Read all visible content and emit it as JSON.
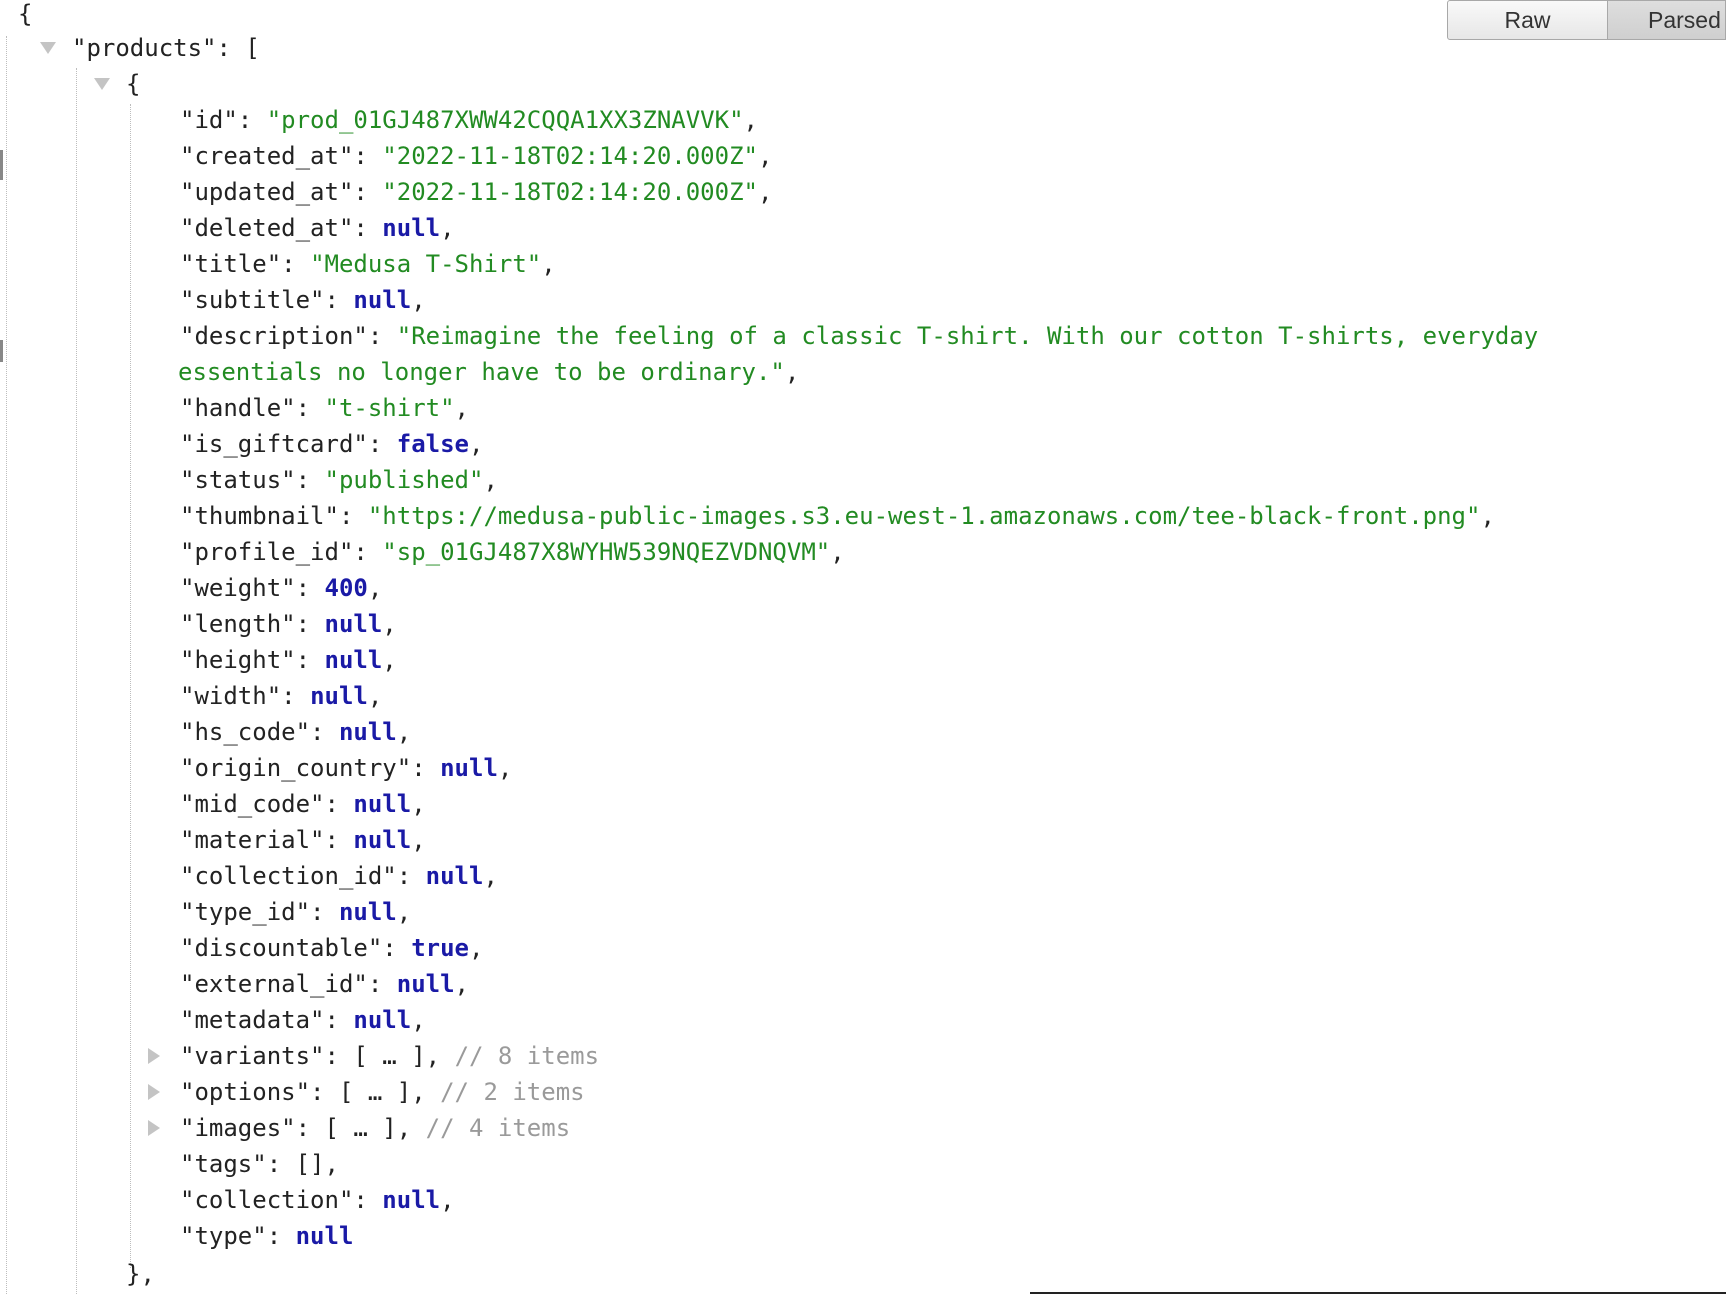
{
  "view_toggle": {
    "raw_label": "Raw",
    "parsed_label": "Parsed"
  },
  "colors": {
    "string": "#228b22",
    "keyword": "#1a1aa6",
    "comment": "#9a9a9a",
    "key": "#222222",
    "guide": "#bdbdbd",
    "toggle": "#c4c4c4"
  },
  "json": {
    "root_open": "{",
    "products_key": "\"products\"",
    "products_open": ": [",
    "item_open": "{",
    "item_close": "},",
    "fields": [
      {
        "key": "\"id\"",
        "value": "\"prod_01GJ487XWW42CQQA1XX3ZNAVVK\"",
        "kind": "str",
        "trail": ","
      },
      {
        "key": "\"created_at\"",
        "value": "\"2022-11-18T02:14:20.000Z\"",
        "kind": "str",
        "trail": ","
      },
      {
        "key": "\"updated_at\"",
        "value": "\"2022-11-18T02:14:20.000Z\"",
        "kind": "str",
        "trail": ","
      },
      {
        "key": "\"deleted_at\"",
        "value": "null",
        "kind": "kw",
        "trail": ","
      },
      {
        "key": "\"title\"",
        "value": "\"Medusa T-Shirt\"",
        "kind": "str",
        "trail": ","
      },
      {
        "key": "\"subtitle\"",
        "value": "null",
        "kind": "kw",
        "trail": ","
      },
      {
        "key": "\"description\"",
        "value": "\"Reimagine the feeling of a classic T-shirt. With our cotton T-shirts, everyday",
        "kind": "str",
        "trail": ""
      },
      {
        "key": "",
        "value": "essentials no longer have to be ordinary.\"",
        "kind": "str",
        "trail": ","
      },
      {
        "key": "\"handle\"",
        "value": "\"t-shirt\"",
        "kind": "str",
        "trail": ","
      },
      {
        "key": "\"is_giftcard\"",
        "value": "false",
        "kind": "kw",
        "trail": ","
      },
      {
        "key": "\"status\"",
        "value": "\"published\"",
        "kind": "str",
        "trail": ","
      },
      {
        "key": "\"thumbnail\"",
        "value": "\"https://medusa-public-images.s3.eu-west-1.amazonaws.com/tee-black-front.png\"",
        "kind": "str",
        "trail": ","
      },
      {
        "key": "\"profile_id\"",
        "value": "\"sp_01GJ487X8WYHW539NQEZVDNQVM\"",
        "kind": "str",
        "trail": ","
      },
      {
        "key": "\"weight\"",
        "value": "400",
        "kind": "kw",
        "trail": ","
      },
      {
        "key": "\"length\"",
        "value": "null",
        "kind": "kw",
        "trail": ","
      },
      {
        "key": "\"height\"",
        "value": "null",
        "kind": "kw",
        "trail": ","
      },
      {
        "key": "\"width\"",
        "value": "null",
        "kind": "kw",
        "trail": ","
      },
      {
        "key": "\"hs_code\"",
        "value": "null",
        "kind": "kw",
        "trail": ","
      },
      {
        "key": "\"origin_country\"",
        "value": "null",
        "kind": "kw",
        "trail": ","
      },
      {
        "key": "\"mid_code\"",
        "value": "null",
        "kind": "kw",
        "trail": ","
      },
      {
        "key": "\"material\"",
        "value": "null",
        "kind": "kw",
        "trail": ","
      },
      {
        "key": "\"collection_id\"",
        "value": "null",
        "kind": "kw",
        "trail": ","
      },
      {
        "key": "\"type_id\"",
        "value": "null",
        "kind": "kw",
        "trail": ","
      },
      {
        "key": "\"discountable\"",
        "value": "true",
        "kind": "kw",
        "trail": ","
      },
      {
        "key": "\"external_id\"",
        "value": "null",
        "kind": "kw",
        "trail": ","
      },
      {
        "key": "\"metadata\"",
        "value": "null",
        "kind": "kw",
        "trail": ","
      }
    ],
    "collapsed": [
      {
        "key": "\"variants\"",
        "value": "[ … ]",
        "trail": ",",
        "comment": "// 8 items"
      },
      {
        "key": "\"options\"",
        "value": "[ … ]",
        "trail": ",",
        "comment": "// 2 items"
      },
      {
        "key": "\"images\"",
        "value": "[ … ]",
        "trail": ",",
        "comment": "// 4 items"
      }
    ],
    "tail_fields": [
      {
        "key": "\"tags\"",
        "value": "[]",
        "kind": "punct",
        "trail": ","
      },
      {
        "key": "\"collection\"",
        "value": "null",
        "kind": "kw",
        "trail": ","
      },
      {
        "key": "\"type\"",
        "value": "null",
        "kind": "kw",
        "trail": ""
      }
    ]
  }
}
